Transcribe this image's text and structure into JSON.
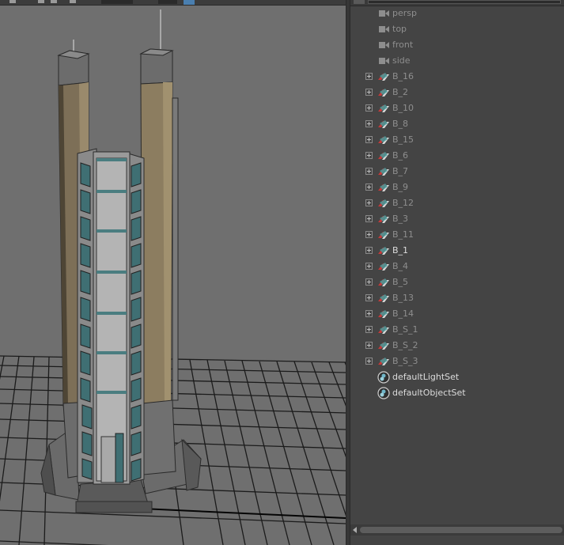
{
  "outliner": {
    "items": [
      {
        "label": "persp",
        "kind": "camera",
        "expandable": false,
        "active": false
      },
      {
        "label": "top",
        "kind": "camera",
        "expandable": false,
        "active": false
      },
      {
        "label": "front",
        "kind": "camera",
        "expandable": false,
        "active": false
      },
      {
        "label": "side",
        "kind": "camera",
        "expandable": false,
        "active": false
      },
      {
        "label": "B_16",
        "kind": "transform",
        "expandable": true,
        "active": false
      },
      {
        "label": "B_2",
        "kind": "transform",
        "expandable": true,
        "active": false
      },
      {
        "label": "B_10",
        "kind": "transform",
        "expandable": true,
        "active": false
      },
      {
        "label": "B_8",
        "kind": "transform",
        "expandable": true,
        "active": false
      },
      {
        "label": "B_15",
        "kind": "transform",
        "expandable": true,
        "active": false
      },
      {
        "label": "B_6",
        "kind": "transform",
        "expandable": true,
        "active": false
      },
      {
        "label": "B_7",
        "kind": "transform",
        "expandable": true,
        "active": false
      },
      {
        "label": "B_9",
        "kind": "transform",
        "expandable": true,
        "active": false
      },
      {
        "label": "B_12",
        "kind": "transform",
        "expandable": true,
        "active": false
      },
      {
        "label": "B_3",
        "kind": "transform",
        "expandable": true,
        "active": false
      },
      {
        "label": "B_11",
        "kind": "transform",
        "expandable": true,
        "active": false
      },
      {
        "label": "B_1",
        "kind": "transform",
        "expandable": true,
        "active": true
      },
      {
        "label": "B_4",
        "kind": "transform",
        "expandable": true,
        "active": false
      },
      {
        "label": "B_5",
        "kind": "transform",
        "expandable": true,
        "active": false
      },
      {
        "label": "B_13",
        "kind": "transform",
        "expandable": true,
        "active": false
      },
      {
        "label": "B_14",
        "kind": "transform",
        "expandable": true,
        "active": false
      },
      {
        "label": "B_S_1",
        "kind": "transform",
        "expandable": true,
        "active": false
      },
      {
        "label": "B_S_2",
        "kind": "transform",
        "expandable": true,
        "active": false
      },
      {
        "label": "B_S_3",
        "kind": "transform",
        "expandable": true,
        "active": false
      },
      {
        "label": "defaultLightSet",
        "kind": "set",
        "expandable": false,
        "active": true
      },
      {
        "label": "defaultObjectSet",
        "kind": "set",
        "expandable": false,
        "active": true
      }
    ]
  },
  "colors": {
    "viewport_bg": "#6f6f6f",
    "panel_bg": "#444444",
    "text_dim": "#8e8e8e",
    "text_active": "#dcdcdc",
    "grid": "#1a1a1a",
    "tower_tan": "#8a7a5c",
    "glass_teal": "#3f6f73"
  }
}
